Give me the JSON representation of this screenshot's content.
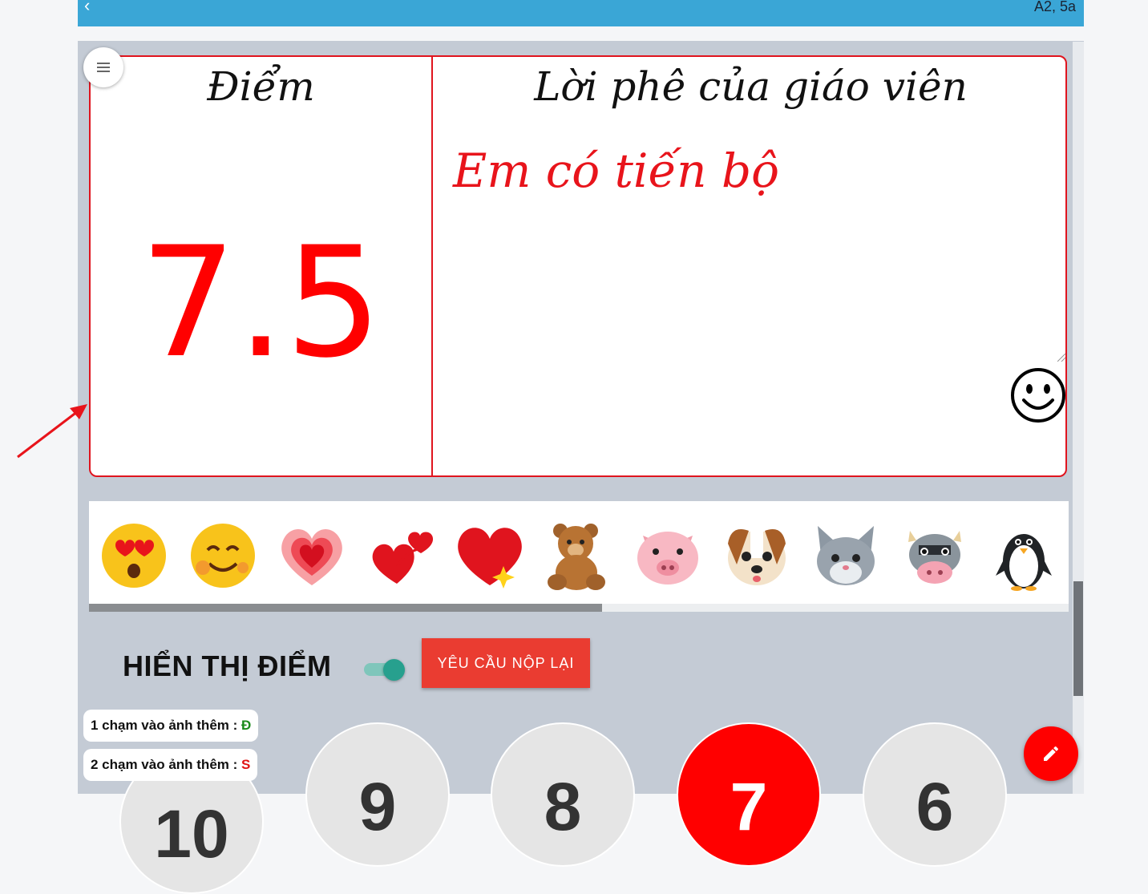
{
  "header": {
    "back_icon": "chevron-left-icon",
    "class_label": "A2, 5a",
    "bar_color": "#3aa6d6"
  },
  "grade_card": {
    "score_heading": "Điểm",
    "score_value": "7.5",
    "comment_heading": "Lời phê của giáo viên",
    "comment_text": "Em có tiến bộ",
    "accent_color": "#e0141e"
  },
  "stickers": [
    {
      "name": "heart-eyes-face-icon"
    },
    {
      "name": "smiling-face-hearts-icon"
    },
    {
      "name": "glowing-heart-icon"
    },
    {
      "name": "two-hearts-icon"
    },
    {
      "name": "sparkle-heart-icon"
    },
    {
      "name": "teddy-bear-icon"
    },
    {
      "name": "pig-face-icon"
    },
    {
      "name": "dog-face-icon"
    },
    {
      "name": "cat-face-icon"
    },
    {
      "name": "cow-face-icon"
    },
    {
      "name": "penguin-icon"
    }
  ],
  "controls": {
    "show_score_label": "HIỂN THỊ ĐIỂM",
    "show_score_on": true,
    "resubmit_label": "YÊU CẦU NỘP LẠI"
  },
  "hints": {
    "single_tap_text": "1 chạm vào ảnh thêm :",
    "single_tap_mark": "Đ",
    "double_tap_text": "2 chạm vào ảnh thêm :",
    "double_tap_mark": "S"
  },
  "score_options": [
    "10",
    "9",
    "8",
    "7",
    "6"
  ],
  "selected_score": "7",
  "icons": {
    "menu": "menu-icon",
    "smiley": "smiley-icon",
    "edit": "pencil-icon"
  }
}
